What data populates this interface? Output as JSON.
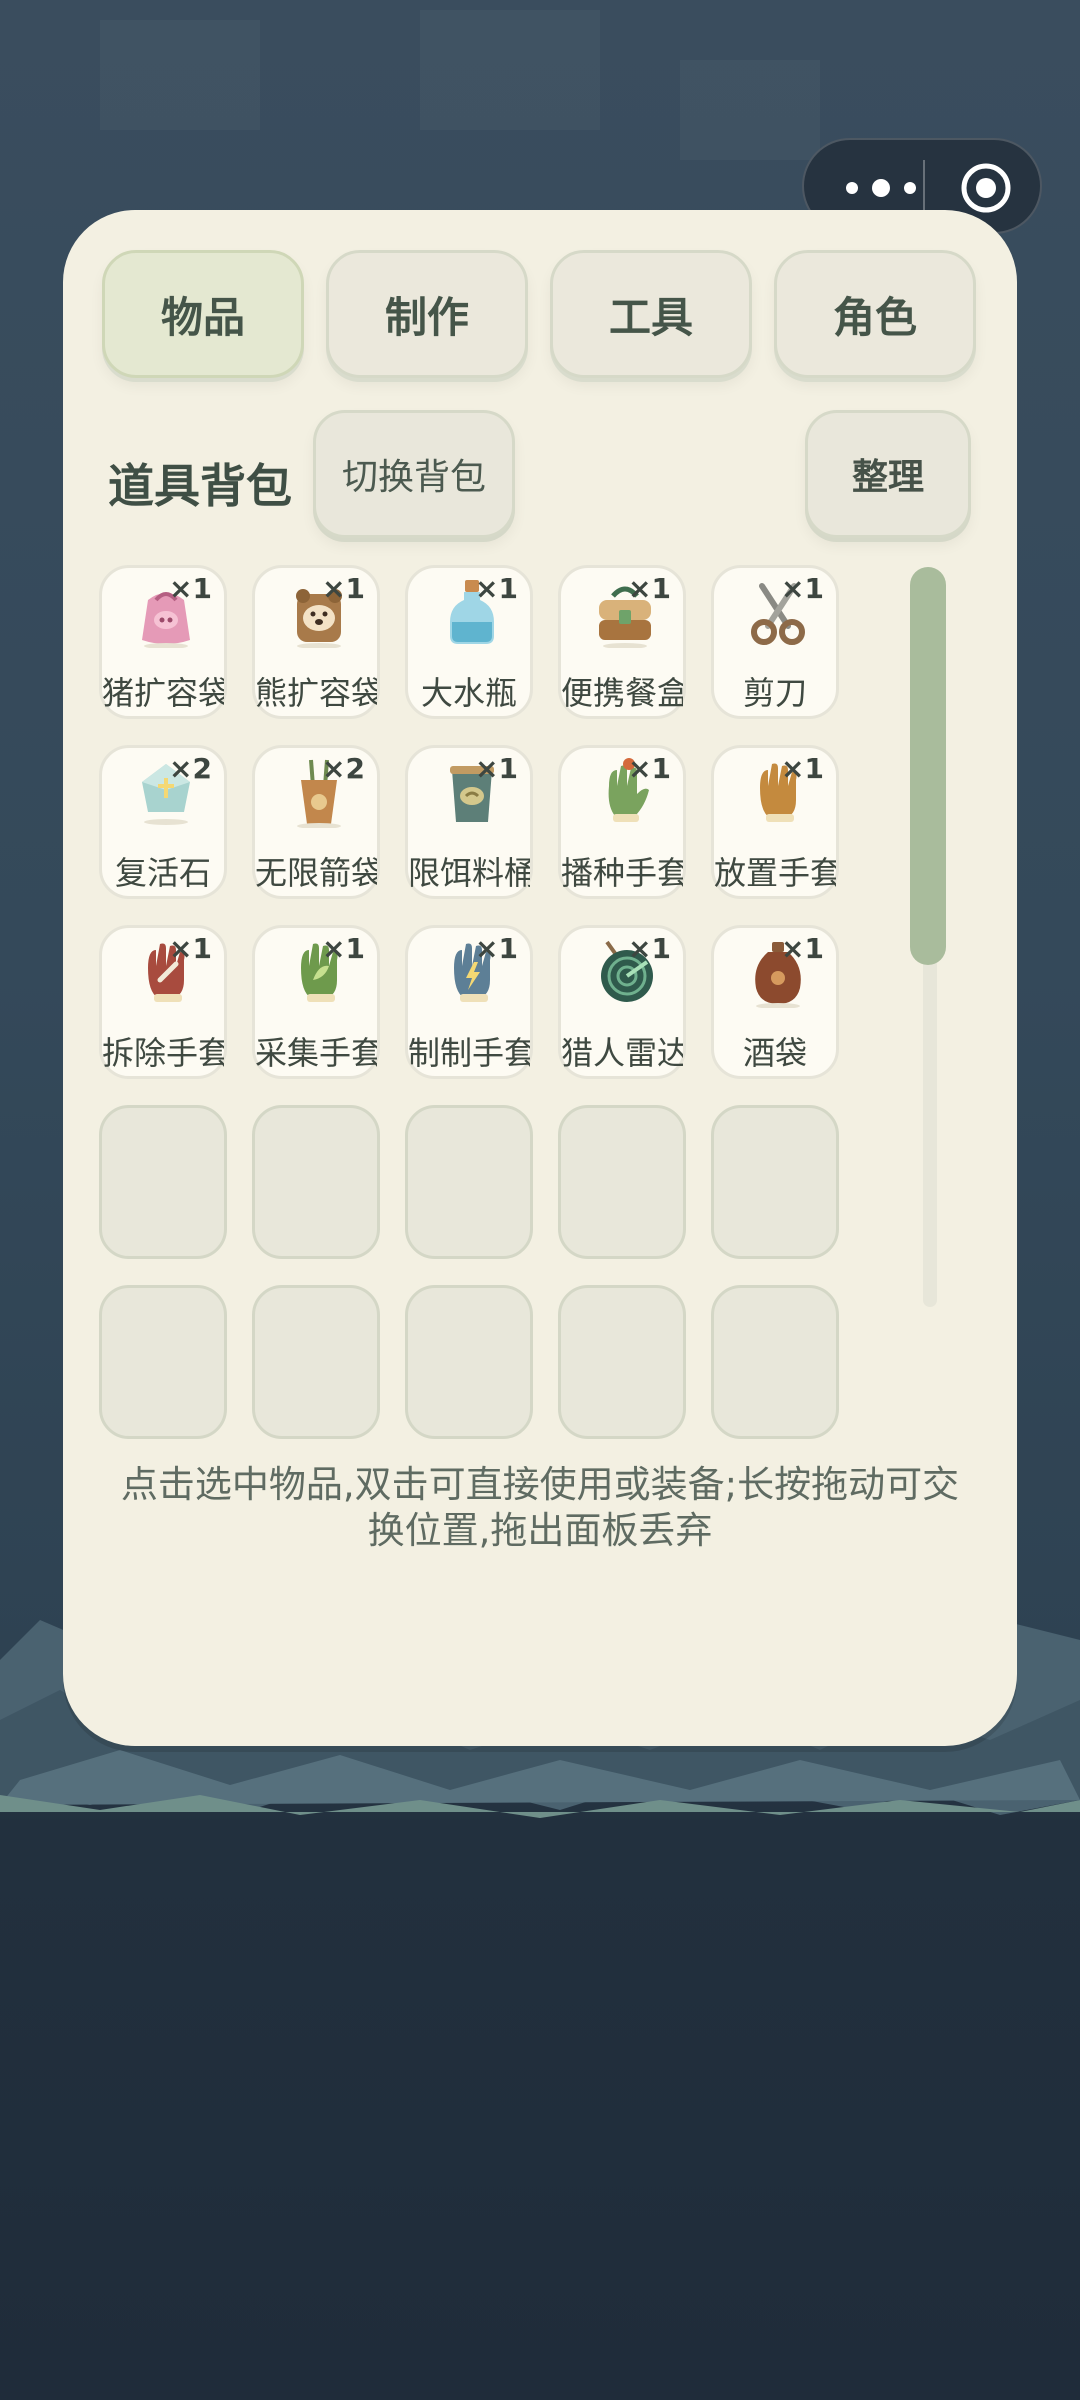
{
  "colors": {
    "panel": "#f3f0e2",
    "active_tab": "#e4e8d1",
    "scroll_thumb": "#a9bc9c",
    "background_top": "#3a4d5e",
    "background_bottom": "#1f2c3a"
  },
  "tabs": [
    {
      "label": "物品",
      "active": true
    },
    {
      "label": "制作",
      "active": false
    },
    {
      "label": "工具",
      "active": false
    },
    {
      "label": "角色",
      "active": false
    }
  ],
  "bag": {
    "title": "道具背包",
    "switch_label": "切换背包",
    "sort_label": "整理"
  },
  "items": [
    {
      "name": "猪扩容袋",
      "count": "×1",
      "icon": "pig-bag-icon"
    },
    {
      "name": "熊扩容袋",
      "count": "×1",
      "icon": "bear-bag-icon"
    },
    {
      "name": "大水瓶",
      "count": "×1",
      "icon": "water-bottle-icon"
    },
    {
      "name": "便携餐盒",
      "count": "×1",
      "icon": "lunch-box-icon"
    },
    {
      "name": "剪刀",
      "count": "×1",
      "icon": "scissors-icon"
    },
    {
      "name": "复活石",
      "count": "×2",
      "icon": "revive-stone-icon"
    },
    {
      "name": "无限箭袋",
      "count": "×2",
      "icon": "quiver-icon"
    },
    {
      "name": "限饵料桶",
      "count": "×1",
      "icon": "bait-bucket-icon"
    },
    {
      "name": "播种手套",
      "count": "×1",
      "icon": "sowing-glove-icon"
    },
    {
      "name": "放置手套",
      "count": "×1",
      "icon": "placing-glove-icon"
    },
    {
      "name": "拆除手套",
      "count": "×1",
      "icon": "removal-glove-icon"
    },
    {
      "name": "采集手套",
      "count": "×1",
      "icon": "gathering-glove-icon"
    },
    {
      "name": "制制手套",
      "count": "×1",
      "icon": "crafting-glove-icon"
    },
    {
      "name": "猎人雷达",
      "count": "×1",
      "icon": "radar-icon"
    },
    {
      "name": "酒袋",
      "count": "×1",
      "icon": "wine-pouch-icon"
    }
  ],
  "empty_slots": 10,
  "hint": "点击选中物品,双击可直接使用或装备;长按拖动可交换位置,拖出面板丢弃",
  "capsule": {
    "more_icon": "more-dots-icon",
    "close_icon": "target-circle-icon"
  }
}
